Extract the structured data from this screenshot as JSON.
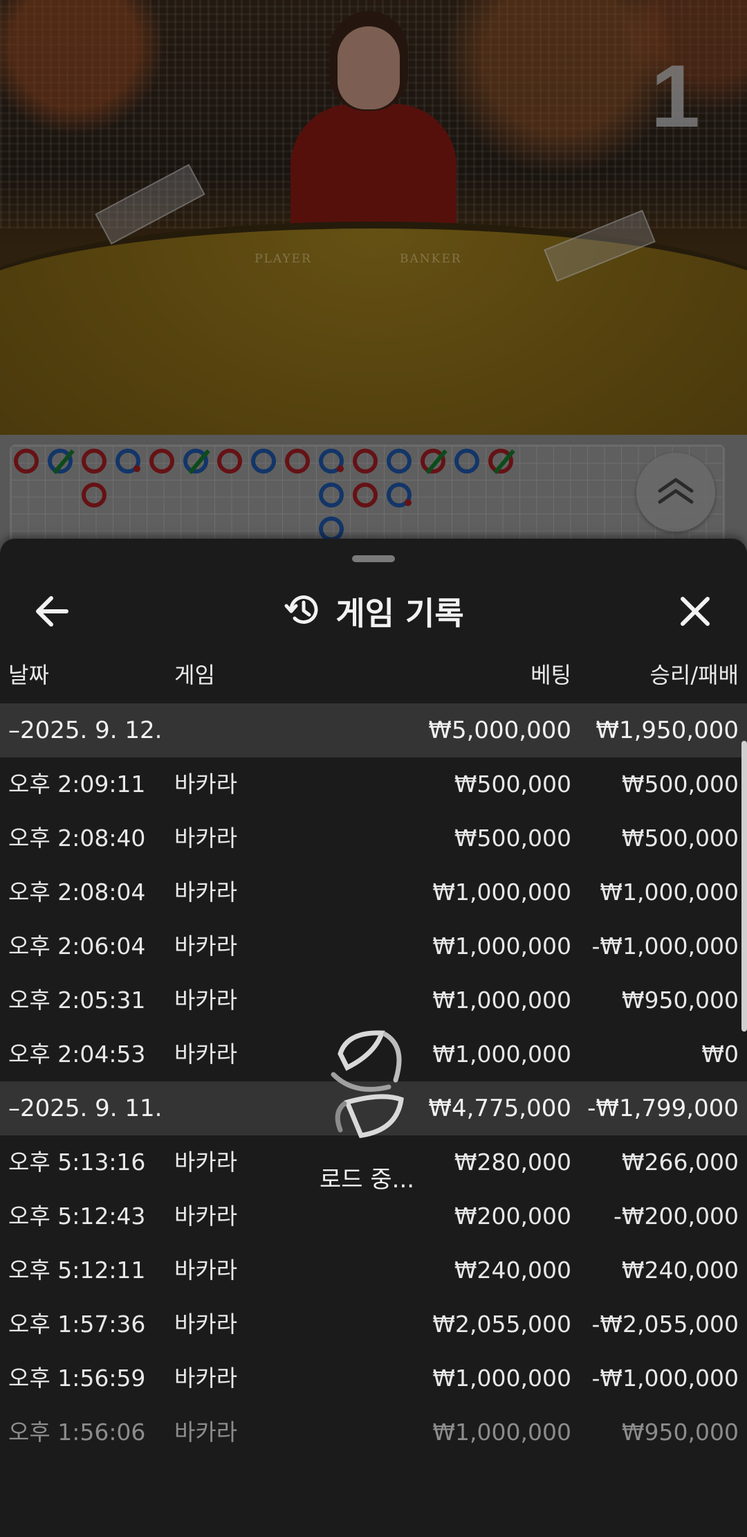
{
  "video": {
    "table_number": "1",
    "player_label": "PLAYER",
    "banker_label": "BANKER"
  },
  "roadmap": {
    "beads": [
      {
        "col": 0,
        "row": 0,
        "color": "red",
        "mark": "none"
      },
      {
        "col": 1,
        "row": 0,
        "color": "blue",
        "mark": "slash"
      },
      {
        "col": 2,
        "row": 0,
        "color": "red",
        "mark": "none"
      },
      {
        "col": 2,
        "row": 1,
        "color": "red",
        "mark": "none"
      },
      {
        "col": 3,
        "row": 0,
        "color": "blue",
        "mark": "dot"
      },
      {
        "col": 4,
        "row": 0,
        "color": "red",
        "mark": "none"
      },
      {
        "col": 5,
        "row": 0,
        "color": "blue",
        "mark": "slash"
      },
      {
        "col": 6,
        "row": 0,
        "color": "red",
        "mark": "none"
      },
      {
        "col": 7,
        "row": 0,
        "color": "blue",
        "mark": "none"
      },
      {
        "col": 8,
        "row": 0,
        "color": "red",
        "mark": "none"
      },
      {
        "col": 9,
        "row": 0,
        "color": "blue",
        "mark": "dot"
      },
      {
        "col": 9,
        "row": 1,
        "color": "blue",
        "mark": "none"
      },
      {
        "col": 9,
        "row": 2,
        "color": "blue",
        "mark": "none"
      },
      {
        "col": 10,
        "row": 0,
        "color": "red",
        "mark": "none"
      },
      {
        "col": 10,
        "row": 1,
        "color": "red",
        "mark": "none"
      },
      {
        "col": 11,
        "row": 0,
        "color": "blue",
        "mark": "none"
      },
      {
        "col": 11,
        "row": 1,
        "color": "blue",
        "mark": "dot"
      },
      {
        "col": 12,
        "row": 0,
        "color": "red",
        "mark": "slash"
      },
      {
        "col": 13,
        "row": 0,
        "color": "blue",
        "mark": "none"
      },
      {
        "col": 14,
        "row": 0,
        "color": "red",
        "mark": "slash"
      }
    ],
    "scroll_up_icon": "double-chevron-up-icon"
  },
  "panel": {
    "title": "게임 기록",
    "back_icon": "arrow-left-icon",
    "history_icon": "history-icon",
    "close_icon": "close-icon",
    "columns": {
      "date": "날짜",
      "game": "게임",
      "bet": "베팅",
      "winloss": "승리/패배"
    },
    "loading_text": "로드 중...",
    "groups": [
      {
        "date": "–2025. 9. 12.",
        "bet": "₩5,000,000",
        "winloss": "₩1,950,000",
        "rows": [
          {
            "time": "오후 2:09:11",
            "game": "바카라",
            "bet": "₩500,000",
            "winloss": "₩500,000"
          },
          {
            "time": "오후 2:08:40",
            "game": "바카라",
            "bet": "₩500,000",
            "winloss": "₩500,000"
          },
          {
            "time": "오후 2:08:04",
            "game": "바카라",
            "bet": "₩1,000,000",
            "winloss": "₩1,000,000"
          },
          {
            "time": "오후 2:06:04",
            "game": "바카라",
            "bet": "₩1,000,000",
            "winloss": "-₩1,000,000"
          },
          {
            "time": "오후 2:05:31",
            "game": "바카라",
            "bet": "₩1,000,000",
            "winloss": "₩950,000"
          },
          {
            "time": "오후 2:04:53",
            "game": "바카라",
            "bet": "₩1,000,000",
            "winloss": "₩0"
          }
        ]
      },
      {
        "date": "–2025. 9. 11.",
        "bet": "₩4,775,000",
        "winloss": "-₩1,799,000",
        "rows": [
          {
            "time": "오후 5:13:16",
            "game": "바카라",
            "bet": "₩280,000",
            "winloss": "₩266,000"
          },
          {
            "time": "오후 5:12:43",
            "game": "바카라",
            "bet": "₩200,000",
            "winloss": "-₩200,000"
          },
          {
            "time": "오후 5:12:11",
            "game": "바카라",
            "bet": "₩240,000",
            "winloss": "₩240,000"
          },
          {
            "time": "오후 1:57:36",
            "game": "바카라",
            "bet": "₩2,055,000",
            "winloss": "-₩2,055,000"
          },
          {
            "time": "오후 1:56:59",
            "game": "바카라",
            "bet": "₩1,000,000",
            "winloss": "-₩1,000,000"
          },
          {
            "time": "오후 1:56:06",
            "game": "바카라",
            "bet": "₩1,000,000",
            "winloss": "₩950,000"
          }
        ]
      }
    ]
  }
}
